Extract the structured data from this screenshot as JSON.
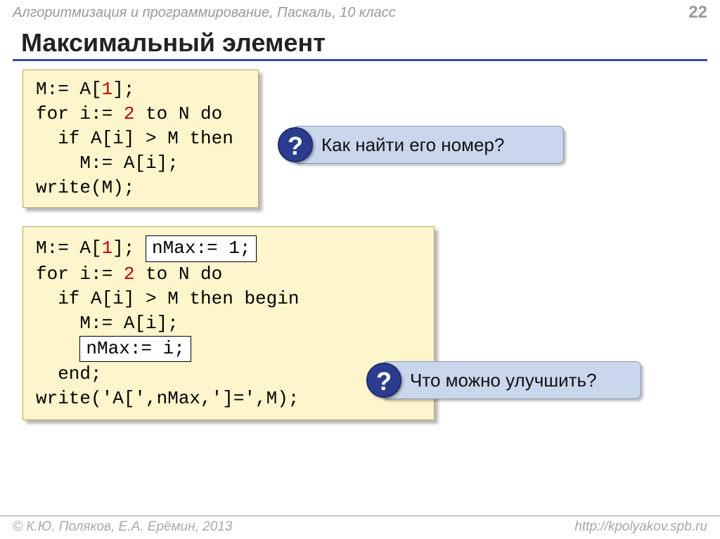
{
  "header": {
    "course": "Алгоритмизация и программирование, Паскаль, 10 класс",
    "page": "22"
  },
  "title": "Максимальный элемент",
  "code1": {
    "l1a": "M:= A[",
    "l1b": "1",
    "l1c": "];",
    "l2a": "for i:= ",
    "l2b": "2",
    "l2c": " to N do",
    "l3a": "  if A[i] > M then",
    "l4a": "    M:= A[i];",
    "l5a": "write(M);"
  },
  "callout1": {
    "mark": "?",
    "text": "Как найти его номер?"
  },
  "code2": {
    "l1a": "M:= A[",
    "l1b": "1",
    "l1c": "]; ",
    "ins1": "nMax:= 1;",
    "l2a": "for i:= ",
    "l2b": "2",
    "l2c": " to N do",
    "l3": "  if A[i] > M then begin",
    "l4": "    M:= A[i];",
    "l5pad": "    ",
    "ins2": "nMax:= i;",
    "l6": "  end;",
    "l7": "write('A[',nMax,']=',M);"
  },
  "callout2": {
    "mark": "?",
    "text": "Что можно улучшить?"
  },
  "footer": {
    "left": "© К.Ю. Поляков, Е.А. Ерёмин, 2013",
    "right": "http://kpolyakov.spb.ru"
  }
}
